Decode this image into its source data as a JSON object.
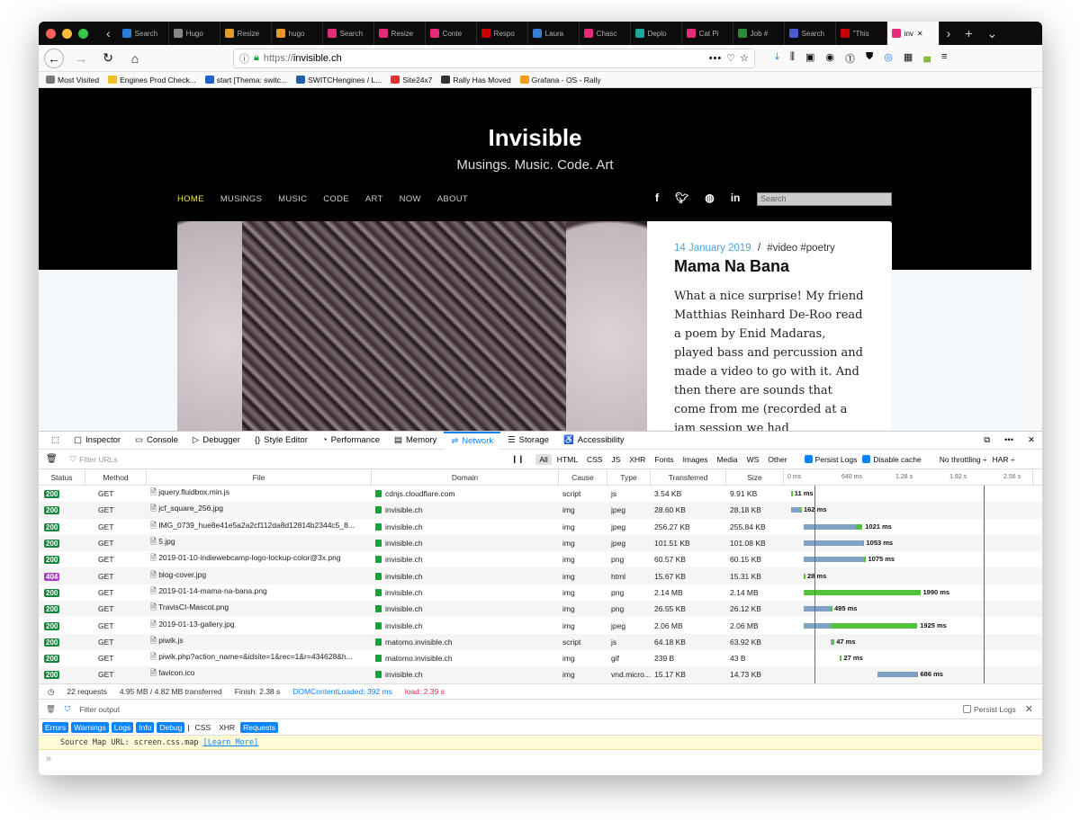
{
  "tabs": [
    {
      "label": "Search",
      "icon": "#2a7bde"
    },
    {
      "label": "Hugo",
      "icon": "#888"
    },
    {
      "label": "Resize",
      "icon": "#e59b2a"
    },
    {
      "label": "hugo",
      "icon": "#e59b2a"
    },
    {
      "label": "Search",
      "icon": "#e52a7a"
    },
    {
      "label": "Resize",
      "icon": "#e52a7a"
    },
    {
      "label": "Conte",
      "icon": "#e52a7a"
    },
    {
      "label": "Respo",
      "icon": "#c00"
    },
    {
      "label": "Laura",
      "icon": "#3a7bd5"
    },
    {
      "label": "Chasc",
      "icon": "#e52a7a"
    },
    {
      "label": "Deplo",
      "icon": "#20a59b"
    },
    {
      "label": "Cat Pi",
      "icon": "#e52a7a"
    },
    {
      "label": "Job #",
      "icon": "#2a8a3a"
    },
    {
      "label": "Search",
      "icon": "#4a5bd5"
    },
    {
      "label": "\"This",
      "icon": "#c00"
    },
    {
      "label": "inv",
      "icon": "#e52a7a",
      "active": true
    }
  ],
  "url": {
    "proto": "https://",
    "host": "invisible.ch"
  },
  "bookmarks": [
    "Most Visited",
    "Engines Prod Check...",
    "start [Thema: switc...",
    "SWITCHengines / L...",
    "Site24x7",
    "Rally Has Moved",
    "Grafana - OS - Rally"
  ],
  "site": {
    "title": "Invisible",
    "subtitle": "Musings. Music. Code. Art",
    "menu": [
      "HOME",
      "MUSINGS",
      "MUSIC",
      "CODE",
      "ART",
      "NOW",
      "ABOUT"
    ],
    "search_placeholder": "Search",
    "social": [
      "f",
      "t",
      "gh",
      "in"
    ]
  },
  "post": {
    "date": "14 January 2019",
    "sep": "/",
    "tags": "#video #poetry",
    "title": "Mama Na Bana",
    "text": "What a nice surprise! My friend Matthias Reinhard De-Roo read a poem by Enid Madaras, played bass and percussion and made a video to go with it. And then there are sounds that come from me (recorded at a jam session we had"
  },
  "devtools": {
    "tabs": [
      "Inspector",
      "Console",
      "Debugger",
      "Style Editor",
      "Performance",
      "Memory",
      "Network",
      "Storage",
      "Accessibility"
    ],
    "active_tab": "Network",
    "filter_placeholder": "Filter URLs",
    "types": [
      "All",
      "HTML",
      "CSS",
      "JS",
      "XHR",
      "Fonts",
      "Images",
      "Media",
      "WS",
      "Other"
    ],
    "persist": "Persist Logs",
    "disable_cache": "Disable cache",
    "throttling": "No throttling ÷",
    "har": "HAR ÷",
    "columns": [
      "Status",
      "Method",
      "File",
      "Domain",
      "Cause",
      "Type",
      "Transferred",
      "Size"
    ],
    "ticks": [
      "0 ms",
      "640 ms",
      "1.28 s",
      "1.92 s",
      "2.56 s"
    ],
    "requests": [
      {
        "status": "200",
        "method": "GET",
        "file": "jquery.fluidbox.min.js",
        "domain": "cdnjs.cloudflare.com",
        "cause": "script",
        "type": "js",
        "transferred": "3.54 KB",
        "size": "9.91 KB",
        "start": 0,
        "wait": 2,
        "recv": 1,
        "label": "11 ms"
      },
      {
        "status": "200",
        "method": "GET",
        "file": "jcf_square_256.jpg",
        "domain": "invisible.ch",
        "cause": "img",
        "type": "jpeg",
        "transferred": "28.60 KB",
        "size": "28.18 KB",
        "start": 0,
        "wait": 42,
        "recv": 2,
        "label": "162 ms"
      },
      {
        "status": "200",
        "method": "GET",
        "file": "IMG_0739_hue8e41e5a2a2cf112da8d12814b2344c5_8...",
        "domain": "invisible.ch",
        "cause": "img",
        "type": "jpeg",
        "transferred": "256.27 KB",
        "size": "255.84 KB",
        "start": 56,
        "wait": 233,
        "recv": 28,
        "label": "1021 ms"
      },
      {
        "status": "200",
        "method": "GET",
        "file": "5.jpg",
        "domain": "invisible.ch",
        "cause": "img",
        "type": "jpeg",
        "transferred": "101.51 KB",
        "size": "101.08 KB",
        "start": 56,
        "wait": 262,
        "recv": 4,
        "label": "1053 ms"
      },
      {
        "status": "200",
        "method": "GET",
        "file": "2019-01-10-indiewebcamp-logo-lockup-color@3x.png",
        "domain": "invisible.ch",
        "cause": "img",
        "type": "png",
        "transferred": "60.57 KB",
        "size": "60.15 KB",
        "start": 56,
        "wait": 268,
        "recv": 6,
        "label": "1075 ms"
      },
      {
        "status": "404",
        "method": "GET",
        "file": "blog-cover.jpg",
        "domain": "invisible.ch",
        "cause": "img",
        "type": "html",
        "transferred": "15.67 KB",
        "size": "15.31 KB",
        "start": 56,
        "wait": 3,
        "recv": 1,
        "label": "28 ms"
      },
      {
        "status": "200",
        "method": "GET",
        "file": "2019-01-14-mama-na-bana.png",
        "domain": "invisible.ch",
        "cause": "img",
        "type": "png",
        "transferred": "2.14 MB",
        "size": "2.14 MB",
        "start": 56,
        "wait": 3,
        "recv": 515,
        "label": "1990 ms"
      },
      {
        "status": "200",
        "method": "GET",
        "file": "TravisCI-Mascot.png",
        "domain": "invisible.ch",
        "cause": "img",
        "type": "png",
        "transferred": "26.55 KB",
        "size": "26.12 KB",
        "start": 56,
        "wait": 122,
        "recv": 2,
        "label": "495 ms"
      },
      {
        "status": "200",
        "method": "GET",
        "file": "2019-01-13-gallery.jpg",
        "domain": "invisible.ch",
        "cause": "img",
        "type": "jpeg",
        "transferred": "2.06 MB",
        "size": "2.06 MB",
        "start": 56,
        "wait": 120,
        "recv": 385,
        "label": "1925 ms"
      },
      {
        "status": "200",
        "method": "GET",
        "file": "piwik.js",
        "domain": "matomo.invisible.ch",
        "cause": "script",
        "type": "js",
        "transferred": "64.18 KB",
        "size": "63.92 KB",
        "start": 177,
        "wait": 10,
        "recv": 2,
        "label": "47 ms"
      },
      {
        "status": "200",
        "method": "GET",
        "file": "piwik.php?action_name=&idsite=1&rec=1&r=434628&h...",
        "domain": "matomo.invisible.ch",
        "cause": "img",
        "type": "gif",
        "transferred": "239 B",
        "size": "43 B",
        "start": 215,
        "wait": 6,
        "recv": 1,
        "label": "27 ms"
      },
      {
        "status": "200",
        "method": "GET",
        "file": "favicon.ico",
        "domain": "invisible.ch",
        "cause": "img",
        "type": "vnd.micro...",
        "transferred": "15.17 KB",
        "size": "14.73 KB",
        "start": 385,
        "wait": 175,
        "recv": 2,
        "label": "686 ms"
      }
    ],
    "summary": {
      "requests": "22 requests",
      "transferred": "4.95 MB / 4.82 MB transferred",
      "finish": "Finish: 2.38 s",
      "dcl": "DOMContentLoaded: 392 ms",
      "load": "load: 2.39 s"
    },
    "console": {
      "filter": "Filter output",
      "persist": "Persist Logs",
      "levels": [
        "Errors",
        "Warnings",
        "Logs",
        "Info",
        "Debug"
      ],
      "extra": [
        "CSS",
        "XHR",
        "Requests"
      ],
      "log": "Source Map URL: screen.css.map",
      "learn": "[Learn More]",
      "prompt": "»"
    }
  }
}
